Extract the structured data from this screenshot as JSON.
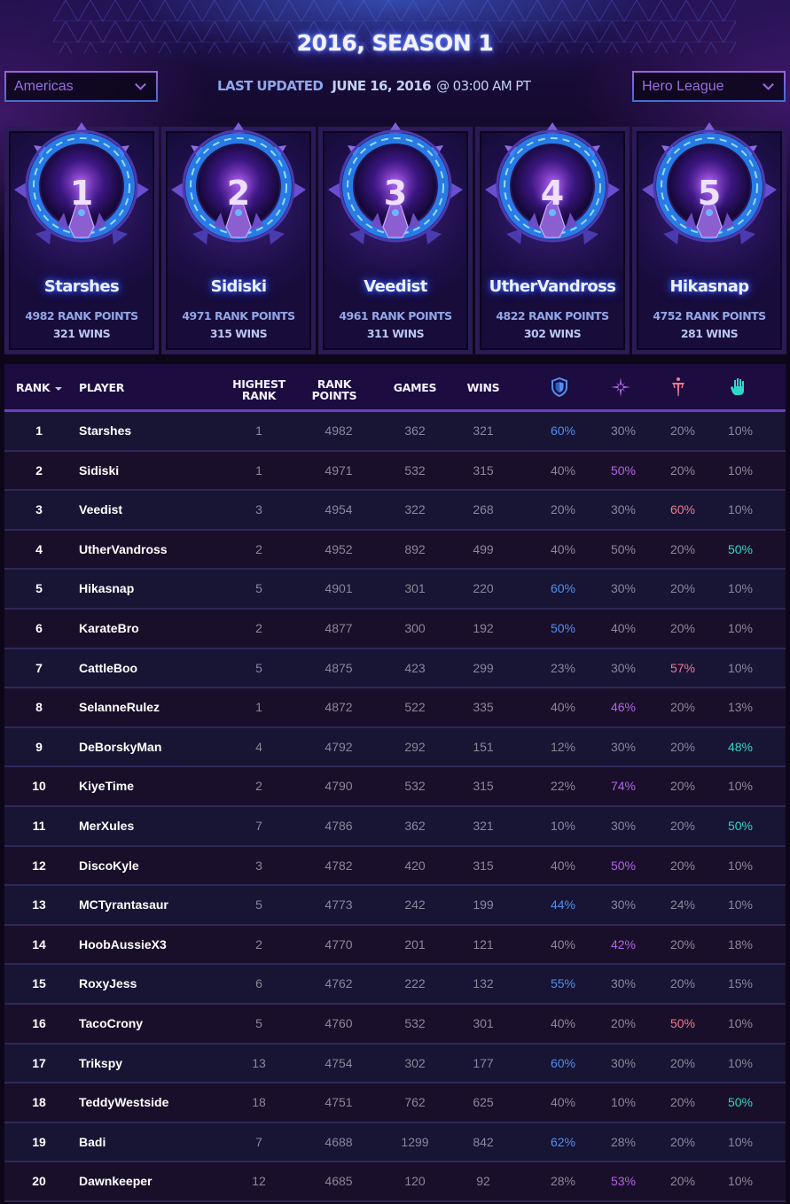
{
  "header": {
    "title": "2016, SEASON 1",
    "region_select": {
      "value": "Americas"
    },
    "league_select": {
      "value": "Hero League"
    },
    "last_updated": {
      "label": "LAST UPDATED",
      "date": "JUNE 16, 2016",
      "time": "@ 03:00 AM PT"
    }
  },
  "top_players": [
    {
      "rank": "1",
      "name": "Starshes",
      "points": "4982 RANK POINTS",
      "wins": "321 WINS"
    },
    {
      "rank": "2",
      "name": "Sidiski",
      "points": "4971 RANK POINTS",
      "wins": "315 WINS"
    },
    {
      "rank": "3",
      "name": "Veedist",
      "points": "4961 RANK POINTS",
      "wins": "311 WINS"
    },
    {
      "rank": "4",
      "name": "UtherVandross",
      "points": "4822 RANK POINTS",
      "wins": "302 WINS"
    },
    {
      "rank": "5",
      "name": "Hikasnap",
      "points": "4752 RANK POINTS",
      "wins": "281 WINS"
    }
  ],
  "table": {
    "columns": {
      "rank": "RANK",
      "player": "PLAYER",
      "highest_rank": [
        "HIGHEST",
        "RANK"
      ],
      "rank_points": [
        "RANK",
        "POINTS"
      ],
      "games": "GAMES",
      "wins": "WINS",
      "role_icons": [
        "warrior-shield-icon",
        "assassin-star-icon",
        "specialist-dagger-icon",
        "support-hand-icon"
      ]
    },
    "role_colors": {
      "warrior": "#4f8ff0",
      "assassin": "#b164e6",
      "specialist": "#f07a8e",
      "support": "#2fd6c8",
      "default": "#8a8798"
    },
    "rows": [
      {
        "rank": "1",
        "player": "Starshes",
        "highest": "1",
        "points": "4982",
        "games": "362",
        "wins": "321",
        "roles": [
          "60%",
          "30%",
          "20%",
          "10%"
        ],
        "hl": 0
      },
      {
        "rank": "2",
        "player": "Sidiski",
        "highest": "1",
        "points": "4971",
        "games": "532",
        "wins": "315",
        "roles": [
          "40%",
          "50%",
          "20%",
          "10%"
        ],
        "hl": 1
      },
      {
        "rank": "3",
        "player": "Veedist",
        "highest": "3",
        "points": "4954",
        "games": "322",
        "wins": "268",
        "roles": [
          "20%",
          "30%",
          "60%",
          "10%"
        ],
        "hl": 2
      },
      {
        "rank": "4",
        "player": "UtherVandross",
        "highest": "2",
        "points": "4952",
        "games": "892",
        "wins": "499",
        "roles": [
          "40%",
          "50%",
          "20%",
          "50%"
        ],
        "hl": 3
      },
      {
        "rank": "5",
        "player": "Hikasnap",
        "highest": "5",
        "points": "4901",
        "games": "301",
        "wins": "220",
        "roles": [
          "60%",
          "30%",
          "20%",
          "10%"
        ],
        "hl": 0
      },
      {
        "rank": "6",
        "player": "KarateBro",
        "highest": "2",
        "points": "4877",
        "games": "300",
        "wins": "192",
        "roles": [
          "50%",
          "40%",
          "20%",
          "10%"
        ],
        "hl": 0
      },
      {
        "rank": "7",
        "player": "CattleBoo",
        "highest": "5",
        "points": "4875",
        "games": "423",
        "wins": "299",
        "roles": [
          "23%",
          "30%",
          "57%",
          "10%"
        ],
        "hl": 2
      },
      {
        "rank": "8",
        "player": "SelanneRulez",
        "highest": "1",
        "points": "4872",
        "games": "522",
        "wins": "335",
        "roles": [
          "40%",
          "46%",
          "20%",
          "13%"
        ],
        "hl": 1
      },
      {
        "rank": "9",
        "player": "DeBorskyMan",
        "highest": "4",
        "points": "4792",
        "games": "292",
        "wins": "151",
        "roles": [
          "12%",
          "30%",
          "20%",
          "48%"
        ],
        "hl": 3
      },
      {
        "rank": "10",
        "player": "KiyeTime",
        "highest": "2",
        "points": "4790",
        "games": "532",
        "wins": "315",
        "roles": [
          "22%",
          "74%",
          "20%",
          "10%"
        ],
        "hl": 1
      },
      {
        "rank": "11",
        "player": "MerXules",
        "highest": "7",
        "points": "4786",
        "games": "362",
        "wins": "321",
        "roles": [
          "10%",
          "30%",
          "20%",
          "50%"
        ],
        "hl": 3
      },
      {
        "rank": "12",
        "player": "DiscoKyle",
        "highest": "3",
        "points": "4782",
        "games": "420",
        "wins": "315",
        "roles": [
          "40%",
          "50%",
          "20%",
          "10%"
        ],
        "hl": 1
      },
      {
        "rank": "13",
        "player": "MCTyrantasaur",
        "highest": "5",
        "points": "4773",
        "games": "242",
        "wins": "199",
        "roles": [
          "44%",
          "30%",
          "24%",
          "10%"
        ],
        "hl": 0
      },
      {
        "rank": "14",
        "player": "HoobAussieX3",
        "highest": "2",
        "points": "4770",
        "games": "201",
        "wins": "121",
        "roles": [
          "40%",
          "42%",
          "20%",
          "18%"
        ],
        "hl": 1
      },
      {
        "rank": "15",
        "player": "RoxyJess",
        "highest": "6",
        "points": "4762",
        "games": "222",
        "wins": "132",
        "roles": [
          "55%",
          "30%",
          "20%",
          "15%"
        ],
        "hl": 0
      },
      {
        "rank": "16",
        "player": "TacoCrony",
        "highest": "5",
        "points": "4760",
        "games": "532",
        "wins": "301",
        "roles": [
          "40%",
          "20%",
          "50%",
          "10%"
        ],
        "hl": 2
      },
      {
        "rank": "17",
        "player": "Trikspy",
        "highest": "13",
        "points": "4754",
        "games": "302",
        "wins": "177",
        "roles": [
          "60%",
          "30%",
          "20%",
          "10%"
        ],
        "hl": 0
      },
      {
        "rank": "18",
        "player": "TeddyWestside",
        "highest": "18",
        "points": "4751",
        "games": "762",
        "wins": "625",
        "roles": [
          "40%",
          "10%",
          "20%",
          "50%"
        ],
        "hl": 3
      },
      {
        "rank": "19",
        "player": "Badi",
        "highest": "7",
        "points": "4688",
        "games": "1299",
        "wins": "842",
        "roles": [
          "62%",
          "28%",
          "20%",
          "10%"
        ],
        "hl": 0
      },
      {
        "rank": "20",
        "player": "Dawnkeeper",
        "highest": "12",
        "points": "4685",
        "games": "120",
        "wins": "92",
        "roles": [
          "28%",
          "53%",
          "20%",
          "10%"
        ],
        "hl": 1
      }
    ]
  }
}
